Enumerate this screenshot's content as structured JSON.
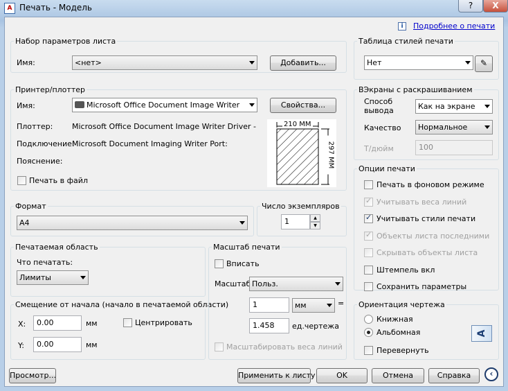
{
  "window": {
    "title": "Печать - Модель",
    "app_icon_text": "A",
    "help_button": "?",
    "close_button": "X"
  },
  "more_info_link": "Подробнее о печати",
  "page_setup": {
    "group": "Набор параметров листа",
    "name_label": "Имя:",
    "name_value": "<нет>",
    "add_button": "Добавить..."
  },
  "plotter": {
    "group": "Принтер/плоттер",
    "name_label": "Имя:",
    "name_value": "Microsoft Office Document Image Writer",
    "properties_button": "Свойства...",
    "plotter_label": "Плоттер:",
    "plotter_value": "Microsoft Office Document Image Writer Driver - Сис...",
    "connection_label": "Подключение:",
    "connection_value": "Microsoft Document Imaging Writer Port:",
    "description_label": "Пояснение:",
    "print_to_file": "Печать в файл",
    "preview_width": "210 MM",
    "preview_height": "297 MM"
  },
  "format": {
    "group": "Формат",
    "value": "A4"
  },
  "copies": {
    "group": "Число экземпляров",
    "value": "1"
  },
  "plot_area": {
    "group": "Печатаемая область",
    "what_label": "Что печатать:",
    "what_value": "Лимиты"
  },
  "offset": {
    "group": "Смещение от начала (начало в печатаемой области)",
    "x_label": "X:",
    "x_value": "0.00",
    "x_unit": "мм",
    "y_label": "Y:",
    "y_value": "0.00",
    "y_unit": "мм",
    "center": "Центрировать"
  },
  "scale": {
    "group": "Масштаб печати",
    "fit": "Вписать",
    "scale_label": "Масштаб:",
    "scale_value": "Польз.",
    "value1": "1",
    "unit1": "мм",
    "equals": "=",
    "value2": "1.458",
    "unit2": "ед.чертежа",
    "scale_lineweights": "Масштабировать веса линий"
  },
  "style_table": {
    "group": "Таблица стилей печати",
    "value": "Нет"
  },
  "shaded": {
    "group": "ВЭкраны с раскрашиванием",
    "output_label_1": "Способ",
    "output_label_2": "вывода",
    "output_value": "Как на экране",
    "quality_label": "Качество",
    "quality_value": "Нормальное",
    "dpi_label": "Т/дюйм",
    "dpi_value": "100"
  },
  "options": {
    "group": "Опции печати",
    "items": [
      {
        "label": "Печать в фоновом режиме",
        "checked": false,
        "disabled": false
      },
      {
        "label": "Учитывать веса линий",
        "checked": true,
        "disabled": true
      },
      {
        "label": "Учитывать стили печати",
        "checked": true,
        "disabled": false
      },
      {
        "label": "Объекты листа последними",
        "checked": true,
        "disabled": true
      },
      {
        "label": "Скрывать объекты листа",
        "checked": false,
        "disabled": true
      },
      {
        "label": "Штемпель вкл",
        "checked": false,
        "disabled": false
      },
      {
        "label": "Сохранить параметры",
        "checked": false,
        "disabled": false
      }
    ]
  },
  "orientation": {
    "group": "Ориентация чертежа",
    "portrait": "Книжная",
    "landscape": "Альбомная",
    "upside_down": "Перевернуть",
    "preview_letter": "A"
  },
  "buttons": {
    "preview": "Просмотр...",
    "apply": "Применить к листу",
    "ok": "OK",
    "cancel": "Отмена",
    "help": "Справка"
  }
}
